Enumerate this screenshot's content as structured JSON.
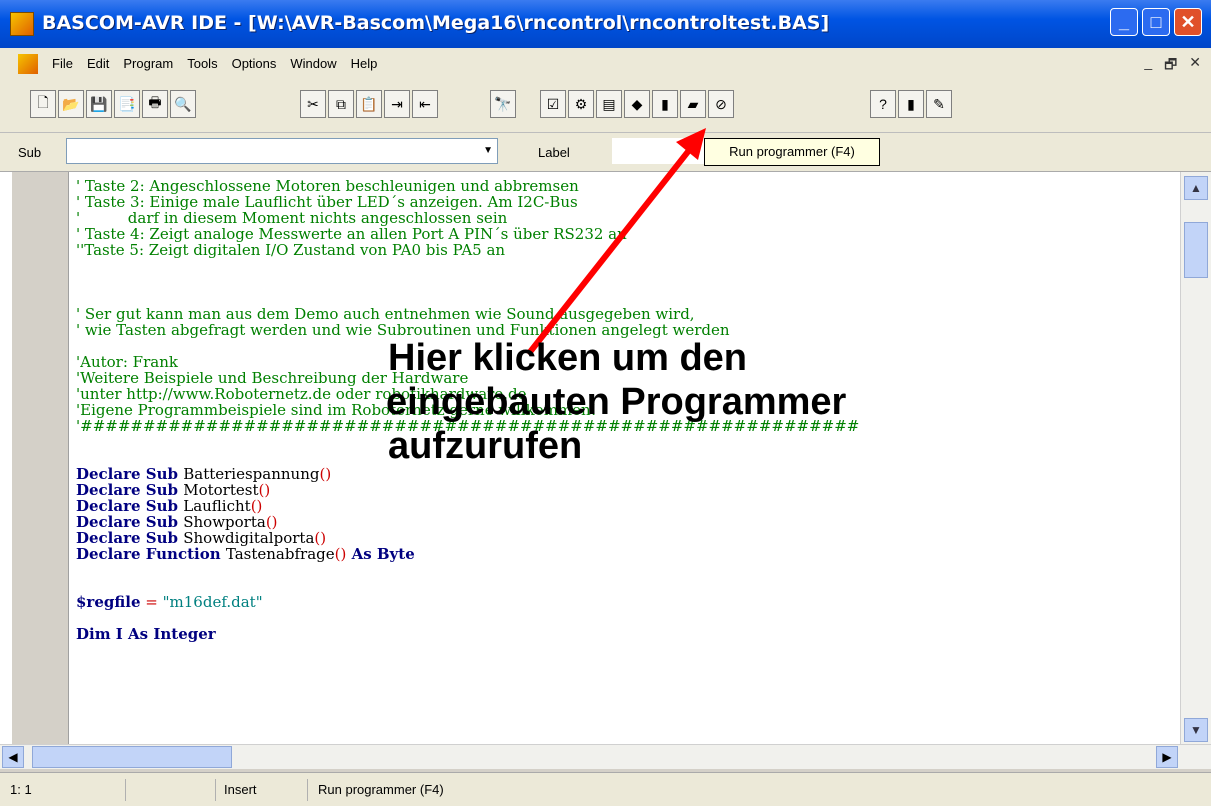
{
  "window": {
    "title": "BASCOM-AVR IDE - [W:\\AVR-Bascom\\Mega16\\rncontrol\\rncontroltest.BAS]",
    "min_glyph": "_",
    "max_glyph": "□",
    "close_glyph": "✕"
  },
  "menu": {
    "items": [
      "File",
      "Edit",
      "Program",
      "Tools",
      "Options",
      "Window",
      "Help"
    ],
    "mdi_minimize": "_",
    "mdi_restore": "🗗",
    "mdi_close": "✕"
  },
  "toolbar": {
    "groups": [
      [
        "new-file-icon",
        "open-file-icon",
        "save-icon",
        "save-as-icon",
        "print-icon",
        "print-preview-icon"
      ],
      [
        "cut-icon",
        "copy-icon",
        "paste-icon",
        "indent-icon",
        "unindent-icon"
      ],
      [
        "find-icon"
      ],
      [
        "check-syntax-icon",
        "compile-icon",
        "compiled-result-icon",
        "simulate-icon",
        "run-programmer-icon",
        "send-to-chip-icon",
        "stop-icon"
      ],
      [
        "help-icon",
        "exit-icon",
        "tip-icon"
      ]
    ],
    "glyphs": {
      "new-file-icon": "🗋",
      "open-file-icon": "📂",
      "save-icon": "💾",
      "save-as-icon": "📑",
      "print-icon": "🖶",
      "print-preview-icon": "🔍",
      "cut-icon": "✂",
      "copy-icon": "⧉",
      "paste-icon": "📋",
      "indent-icon": "⇥",
      "unindent-icon": "⇤",
      "find-icon": "🔭",
      "check-syntax-icon": "☑",
      "compile-icon": "⚙",
      "compiled-result-icon": "▤",
      "simulate-icon": "◆",
      "run-programmer-icon": "▮",
      "send-to-chip-icon": "▰",
      "stop-icon": "⊘",
      "help-icon": "?",
      "exit-icon": "▮",
      "tip-icon": "✎"
    }
  },
  "subbar": {
    "sub_label": "Sub",
    "label_label": "Label",
    "tooltip": "Run programmer (F4)"
  },
  "editor": {
    "lines": [
      {
        "t": "comment",
        "text": "' Taste 2: Angeschlossene Motoren beschleunigen und abbremsen"
      },
      {
        "t": "comment",
        "text": "' Taste 3: Einige male Lauflicht über LED´s anzeigen. Am I2C-Bus"
      },
      {
        "t": "comment",
        "text": "'          darf in diesem Moment nichts angeschlossen sein"
      },
      {
        "t": "comment",
        "text": "' Taste 4: Zeigt analoge Messwerte an allen Port A PIN´s über RS232 an"
      },
      {
        "t": "comment",
        "text": "''Taste 5: Zeigt digitalen I/O Zustand von PA0 bis PA5 an"
      },
      {
        "t": "blank",
        "text": ""
      },
      {
        "t": "blank",
        "text": ""
      },
      {
        "t": "blank",
        "text": ""
      },
      {
        "t": "comment",
        "text": "' Ser gut kann man aus dem Demo auch entnehmen wie Sound ausgegeben wird,"
      },
      {
        "t": "comment",
        "text": "' wie Tasten abgefragt werden und wie Subroutinen und Funktionen angelegt werden"
      },
      {
        "t": "blank",
        "text": ""
      },
      {
        "t": "comment",
        "text": "'Autor: Frank"
      },
      {
        "t": "comment",
        "text": "'Weitere Beispiele und Beschreibung der Hardware"
      },
      {
        "t": "comment",
        "text": "'unter http://www.Roboternetz.de oder robotikhardware.de"
      },
      {
        "t": "comment",
        "text": "'Eigene Programmbeispiele sind im Roboternetz gerne willkommen!"
      },
      {
        "t": "comment",
        "text": "'##############################################################"
      },
      {
        "t": "blank",
        "text": ""
      },
      {
        "t": "blank",
        "text": ""
      },
      {
        "t": "decl",
        "kw": "Declare Sub",
        "name": "Batteriespannung"
      },
      {
        "t": "decl",
        "kw": "Declare Sub",
        "name": "Motortest"
      },
      {
        "t": "decl",
        "kw": "Declare Sub",
        "name": "Lauflicht"
      },
      {
        "t": "decl",
        "kw": "Declare Sub",
        "name": "Showporta"
      },
      {
        "t": "decl",
        "kw": "Declare Sub",
        "name": "Showdigitalporta"
      },
      {
        "t": "declf",
        "kw": "Declare Function",
        "name": "Tastenabfrage",
        "suffix": "As Byte"
      },
      {
        "t": "blank",
        "text": ""
      },
      {
        "t": "blank",
        "text": ""
      },
      {
        "t": "assign",
        "kw": "$regfile",
        "value": "\"m16def.dat\""
      },
      {
        "t": "blank",
        "text": ""
      },
      {
        "t": "dim",
        "text": "Dim I As Integer"
      }
    ]
  },
  "annotation": {
    "line1": "Hier klicken um den",
    "line2": "eingebauten Programmer",
    "line3": "aufzurufen",
    "arrow_color": "#ff0000"
  },
  "status": {
    "position": "1: 1",
    "mode": "Insert",
    "message": "Run programmer (F4)"
  }
}
